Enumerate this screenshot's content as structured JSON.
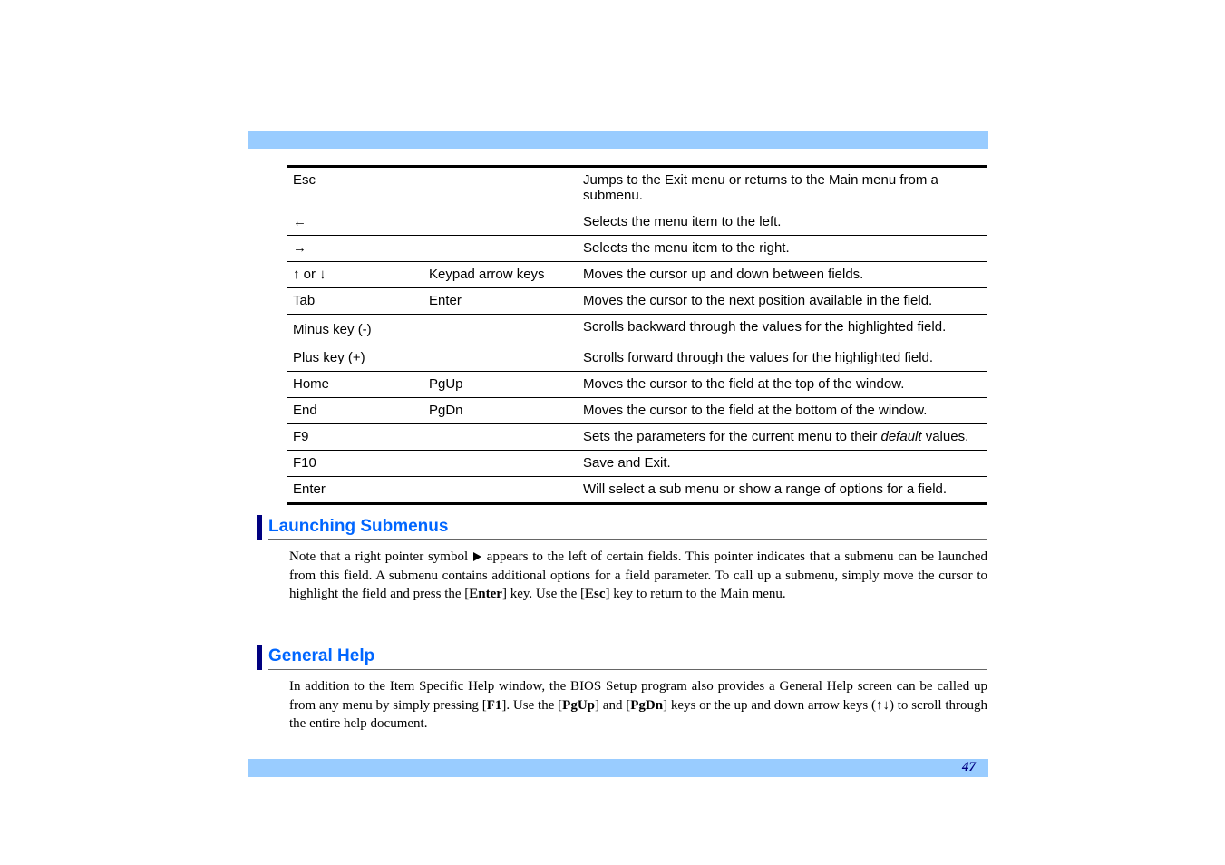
{
  "page_number": "47",
  "table": {
    "rows": [
      {
        "key": "Esc",
        "alt": "",
        "desc": "Jumps to the Exit menu or returns to the Main menu from a submenu."
      },
      {
        "key": "←",
        "alt": "",
        "desc": "Selects the menu item to the left."
      },
      {
        "key": "→",
        "alt": "",
        "desc": "Selects the menu item to the right."
      },
      {
        "key": "↑ or ↓",
        "alt": "Keypad arrow keys",
        "desc": "Moves the cursor up and down between fields."
      },
      {
        "key": "Tab",
        "alt": "Enter",
        "desc": "Moves the cursor to the next position available in the field."
      },
      {
        "key": "Minus key (-)",
        "alt": "",
        "desc": "Scrolls backward through the values for the highlighted field."
      },
      {
        "key": "Plus key (+)",
        "alt": "",
        "desc": "Scrolls forward through the values for the highlighted field."
      },
      {
        "key": "Home",
        "alt": "PgUp",
        "desc": "Moves the cursor to the field at the top of the window."
      },
      {
        "key": "End",
        "alt": "PgDn",
        "desc": "Moves the cursor to the field at the bottom of the window."
      },
      {
        "key": "F9",
        "alt": "",
        "desc_prefix": "Sets the parameters for the current menu to their ",
        "desc_emph": "default",
        "desc_suffix": " values."
      },
      {
        "key": "F10",
        "alt": "",
        "desc": "Save and Exit."
      },
      {
        "key": "Enter",
        "alt": "",
        "desc": "Will select a sub menu or show a range of options for a field."
      }
    ]
  },
  "section1": {
    "title": "Launching Submenus",
    "p_a": "Note that a right pointer symbol ",
    "p_b": " appears to the left of certain fields. This pointer indicates that a submenu can be launched from this field. A submenu contains additional options for a field parameter. To call up a submenu, simply move the cursor to highlight the field and press the [",
    "enter": "Enter",
    "p_c": "] key. Use the [",
    "esc": "Esc",
    "p_d": "] key to return to the Main menu."
  },
  "section2": {
    "title": "General Help",
    "p_a": "In addition to the Item Specific Help window, the BIOS Setup program also provides a General Help screen can be called up from any menu by simply pressing [",
    "f1": "F1",
    "p_b": "]. Use the [",
    "pgup": "PgUp",
    "p_c": "] and [",
    "pgdn": "PgDn",
    "p_d": "] keys or the up and down arrow keys (↑↓) to scroll through the entire help document."
  }
}
